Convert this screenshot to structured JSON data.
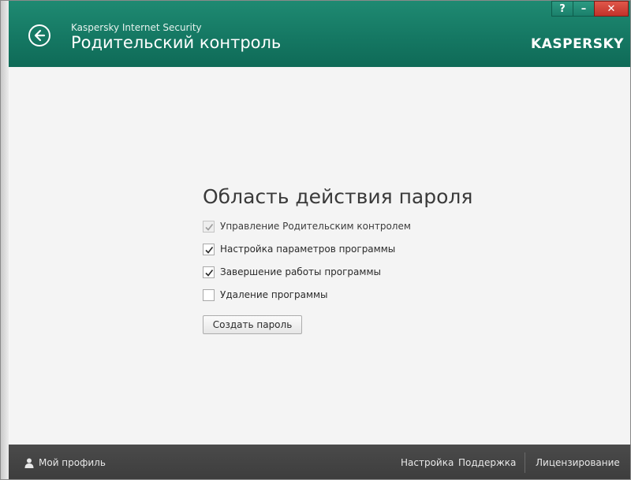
{
  "header": {
    "app_name": "Kaspersky Internet Security",
    "page_title": "Родительский контроль",
    "brand": "KASPERSKY",
    "window_controls": {
      "help": "?",
      "minimize": "–",
      "close": "✕"
    }
  },
  "main": {
    "section_title": "Область действия пароля",
    "options": [
      {
        "label": "Управление Родительским контролем",
        "checked": true,
        "disabled": true
      },
      {
        "label": "Настройка параметров программы",
        "checked": true,
        "disabled": false
      },
      {
        "label": "Завершение работы программы",
        "checked": true,
        "disabled": false
      },
      {
        "label": "Удаление программы",
        "checked": false,
        "disabled": false
      }
    ],
    "create_button": "Создать пароль"
  },
  "footer": {
    "profile": "Мой профиль",
    "settings": "Настройка",
    "support": "Поддержка",
    "licensing": "Лицензирование"
  },
  "colors": {
    "header_green": "#157863",
    "footer_dark": "#434343",
    "close_red": "#c1322a"
  }
}
